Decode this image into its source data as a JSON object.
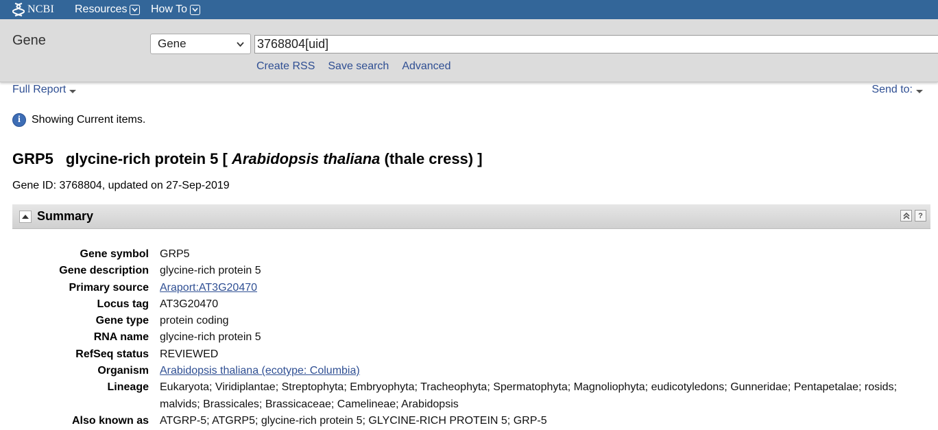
{
  "topbar": {
    "logo_text": "NCBI",
    "menus": [
      "Resources",
      "How To"
    ],
    "icons": {
      "logo": "ncbi-helix-icon",
      "menu_chevron": "chevron-down-icon"
    }
  },
  "search": {
    "db_title": "Gene",
    "db_select": "Gene",
    "term": "3768804[uid]",
    "links": [
      "Create RSS",
      "Save search",
      "Advanced"
    ]
  },
  "display": {
    "format": "Full Report",
    "send_to": "Send to:"
  },
  "info": {
    "message": "Showing Current items."
  },
  "gene": {
    "symbol": "GRP5",
    "name_prefix": "glycine-rich protein 5 [",
    "organism_italic": "Arabidopsis thaliana",
    "organism_suffix": "(thale cress) ]",
    "id_line": "Gene ID: 3768804, updated on 27-Sep-2019"
  },
  "summary": {
    "title": "Summary",
    "rows": [
      {
        "label": "Gene symbol",
        "value": "GRP5",
        "link": false
      },
      {
        "label": "Gene description",
        "value": "glycine-rich protein 5",
        "link": false
      },
      {
        "label": "Primary source",
        "value": "Araport:AT3G20470",
        "link": true
      },
      {
        "label": "Locus tag",
        "value": "AT3G20470",
        "link": false
      },
      {
        "label": "Gene type",
        "value": "protein coding",
        "link": false
      },
      {
        "label": "RNA name",
        "value": "glycine-rich protein 5",
        "link": false
      },
      {
        "label": "RefSeq status",
        "value": "REVIEWED",
        "link": false
      },
      {
        "label": "Organism",
        "value": "Arabidopsis thaliana (ecotype: Columbia)",
        "link": true
      },
      {
        "label": "Lineage",
        "value": "Eukaryota; Viridiplantae; Streptophyta; Embryophyta; Tracheophyta; Spermatophyta; Magnoliophyta; eudicotyledons; Gunneridae; Pentapetalae; rosids; malvids; Brassicales; Brassicaceae; Camelineae; Arabidopsis",
        "link": false
      },
      {
        "label": "Also known as",
        "value": "ATGRP-5; ATGRP5; glycine-rich protein 5; GLYCINE-RICH PROTEIN 5; GRP-5",
        "link": false
      }
    ]
  },
  "colors": {
    "topbar": "#336699",
    "link": "#2f4f93",
    "searchbar": "#dcdcdc"
  }
}
